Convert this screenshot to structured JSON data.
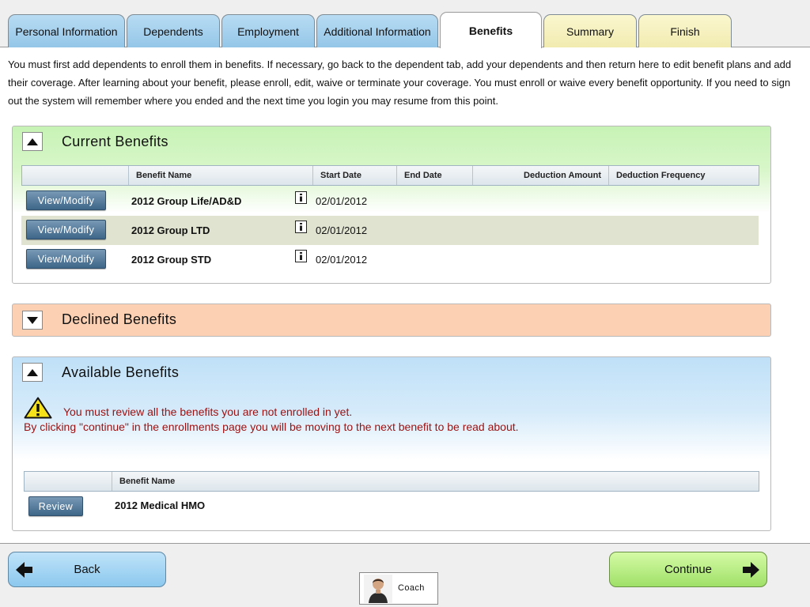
{
  "tabs": [
    {
      "label": "Personal Information"
    },
    {
      "label": "Dependents"
    },
    {
      "label": "Employment"
    },
    {
      "label": "Additional Information"
    },
    {
      "label": "Benefits"
    },
    {
      "label": "Summary"
    },
    {
      "label": "Finish"
    }
  ],
  "active_tab": "Benefits",
  "intro_text": "You must first add dependents to enroll them in benefits. If necessary, go back to the dependent tab, add your dependents and then return here to edit benefit plans and add their coverage. After learning about your benefit, please enroll, edit, waive or terminate your coverage. You must enroll or waive every benefit opportunity. If you need to sign out the system will remember where you ended and the next time you login you may resume from this point.",
  "current_benefits": {
    "title": "Current Benefits",
    "expanded": true,
    "columns": [
      "Benefit Name",
      "Start Date",
      "End Date",
      "Deduction Amount",
      "Deduction Frequency"
    ],
    "rows": [
      {
        "action": "View/Modify",
        "name": "2012 Group Life/AD&D",
        "start_date": "02/01/2012",
        "end_date": "",
        "deduction_amount": "",
        "deduction_frequency": ""
      },
      {
        "action": "View/Modify",
        "name": "2012 Group LTD",
        "start_date": "02/01/2012",
        "end_date": "",
        "deduction_amount": "",
        "deduction_frequency": ""
      },
      {
        "action": "View/Modify",
        "name": "2012 Group STD",
        "start_date": "02/01/2012",
        "end_date": "",
        "deduction_amount": "",
        "deduction_frequency": ""
      }
    ]
  },
  "declined_benefits": {
    "title": "Declined Benefits",
    "expanded": false
  },
  "available_benefits": {
    "title": "Available Benefits",
    "expanded": true,
    "warning_line1": "You must review all the benefits you are not enrolled in yet.",
    "warning_line2": "By clicking \"continue\" in the enrollments page you will be moving to the next benefit to be read about.",
    "columns": [
      "Benefit Name"
    ],
    "rows": [
      {
        "action": "Review",
        "name": "2012 Medical HMO"
      }
    ]
  },
  "footer": {
    "back_label": "Back",
    "continue_label": "Continue",
    "coach_label": "Coach"
  },
  "colors": {
    "tab_blue": "#a9d3ef",
    "tab_yellow": "#f6f1c2",
    "current_panel": "#c7f3b5",
    "declined_panel": "#fcd0b3",
    "available_panel": "#bfe0f8",
    "warning_text": "#9b1111",
    "continue_button": "#b7ee86",
    "back_button": "#a6d6f4"
  },
  "icons": {
    "toggle_expanded": "triangle-up-icon",
    "toggle_collapsed": "triangle-down-icon",
    "info": "info-icon",
    "warning": "warning-triangle-icon",
    "back": "arrow-left-icon",
    "continue": "arrow-right-icon",
    "coach": "coach-avatar"
  }
}
